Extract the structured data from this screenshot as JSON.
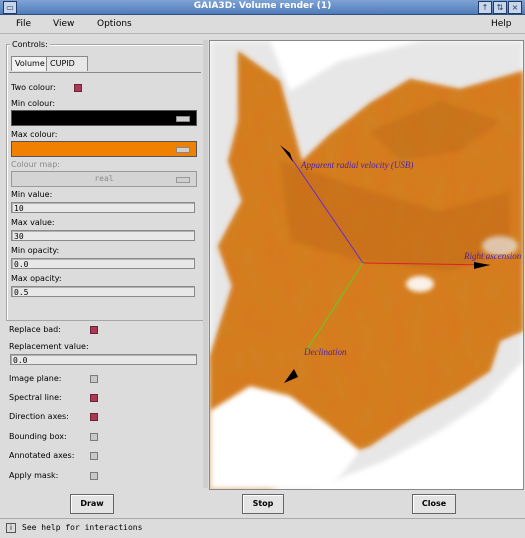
{
  "window": {
    "title": "GAIA3D: Volume render (1)"
  },
  "menu": {
    "file": "File",
    "view": "View",
    "options": "Options",
    "help": "Help"
  },
  "controls": {
    "group_label": "Controls:",
    "tabs": [
      "Volume",
      "CUPID"
    ],
    "two_colour": "Two colour:",
    "min_colour": "Min colour:",
    "max_colour": "Max colour:",
    "colour_map": "Colour map:",
    "colour_map_value": "real",
    "min_value_label": "Min value:",
    "min_value": "10",
    "max_value_label": "Max value:",
    "max_value": "30",
    "min_opacity_label": "Min opacity:",
    "min_opacity": "0.0",
    "max_opacity_label": "Max opacity:",
    "max_opacity": "0.5"
  },
  "options": {
    "replace_bad": "Replace bad:",
    "replacement_value_label": "Replacement value:",
    "replacement_value": "0.0",
    "image_plane": "Image plane:",
    "spectral_line": "Spectral line:",
    "direction_axes": "Direction axes:",
    "bounding_box": "Bounding box:",
    "annotated_axes": "Annotated axes:",
    "apply_mask": "Apply mask:"
  },
  "buttons": {
    "draw": "Draw",
    "stop": "Stop",
    "close": "Close"
  },
  "status": {
    "icon": "i",
    "text": "See help for interactions"
  },
  "viewport": {
    "axis_velocity": "Apparent radial velocity (USB)",
    "axis_ra": "Right ascension",
    "axis_dec": "Declination"
  },
  "colors": {
    "min_colour": "#000000",
    "max_colour": "#f08000",
    "checkbox_on": "#a83a55"
  }
}
